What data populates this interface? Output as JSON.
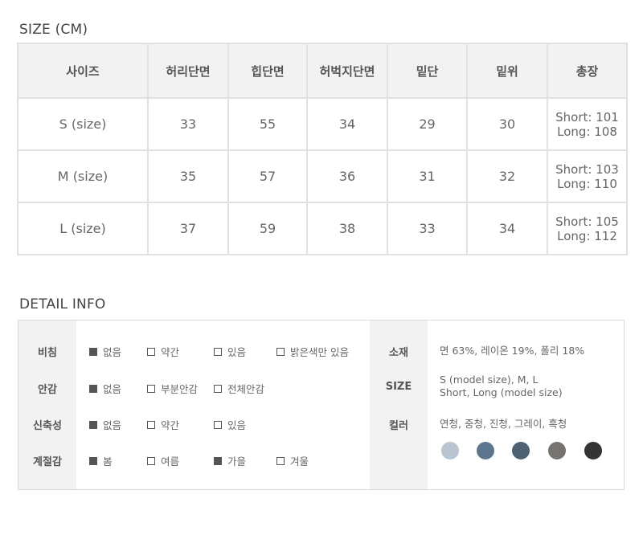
{
  "size_section": {
    "title": "SIZE (CM)",
    "headers": [
      "사이즈",
      "허리단면",
      "힙단면",
      "허벅지단면",
      "밑단",
      "밑위",
      "총장"
    ],
    "rows": [
      {
        "size": "S (size)",
        "waist": "33",
        "hip": "55",
        "thigh": "34",
        "hem": "29",
        "rise": "30",
        "total_short": "Short: 101",
        "total_long": "Long: 108"
      },
      {
        "size": "M (size)",
        "waist": "35",
        "hip": "57",
        "thigh": "36",
        "hem": "31",
        "rise": "32",
        "total_short": "Short: 103",
        "total_long": "Long: 110"
      },
      {
        "size": "L (size)",
        "waist": "37",
        "hip": "59",
        "thigh": "38",
        "hem": "33",
        "rise": "34",
        "total_short": "Short: 105",
        "total_long": "Long: 112"
      }
    ]
  },
  "detail_section": {
    "title": "DETAIL INFO",
    "rows": [
      {
        "label": "비침",
        "options": [
          {
            "text": "없음",
            "checked": true
          },
          {
            "text": "약간",
            "checked": false
          },
          {
            "text": "있음",
            "checked": false
          },
          {
            "text": "밝은색만 있음",
            "checked": false
          }
        ]
      },
      {
        "label": "안감",
        "options": [
          {
            "text": "없음",
            "checked": true
          },
          {
            "text": "부분안감",
            "checked": false
          },
          {
            "text": "전체안감",
            "checked": false
          }
        ]
      },
      {
        "label": "신축성",
        "options": [
          {
            "text": "없음",
            "checked": true
          },
          {
            "text": "약간",
            "checked": false
          },
          {
            "text": "있음",
            "checked": false
          }
        ]
      },
      {
        "label": "계절감",
        "options": [
          {
            "text": "봄",
            "checked": true
          },
          {
            "text": "여름",
            "checked": false
          },
          {
            "text": "가을",
            "checked": true
          },
          {
            "text": "겨울",
            "checked": false
          }
        ]
      }
    ],
    "material": {
      "label": "소재",
      "value": "면 63%, 레이온 19%, 폴리 18%"
    },
    "size_info": {
      "label": "SIZE",
      "line1": "S (model size), M, L",
      "line2": "Short, Long (model size)"
    },
    "color": {
      "label": "컬러",
      "value": "연청, 중청, 진청, 그레이, 흑청",
      "swatches": [
        "#b8c4cf",
        "#5d7690",
        "#4e6274",
        "#777470",
        "#333333"
      ]
    }
  }
}
